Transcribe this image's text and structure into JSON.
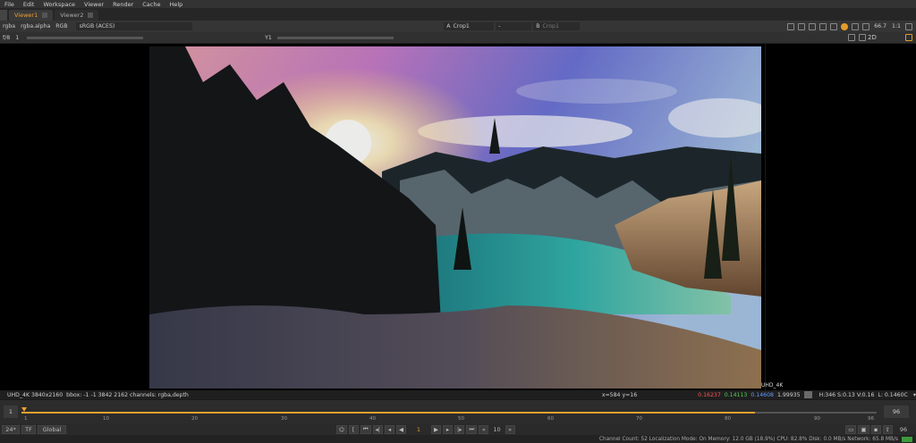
{
  "menu": [
    "File",
    "Edit",
    "Workspace",
    "Viewer",
    "Render",
    "Cache",
    "Help"
  ],
  "tabs": [
    {
      "label": "Viewer1",
      "active": true
    },
    {
      "label": "Viewer2",
      "active": false
    }
  ],
  "toolbar": {
    "channels": "rgba",
    "alpha": "rgba.alpha",
    "display": "RGB",
    "colorspace": "sRGB (ACES)",
    "input_a_letter": "A",
    "input_a": "Crop1",
    "input_a_op": "-",
    "input_b_letter": "B",
    "input_b": "Crop1",
    "zoom": "66.7",
    "ratio": "1:1"
  },
  "toolbar2": {
    "fstop": "f/8",
    "frame_field": "1",
    "y_label": "Y",
    "y_value": "1",
    "view_mode": "2D"
  },
  "viewer": {
    "image_format_label": "UHD_4K"
  },
  "infobar": {
    "format": "UHD_4K 3840x2160",
    "bbox": "bbox: -1 -1 3842 2162 channels: rgba,depth",
    "coords": "x=584 y=16",
    "r": "0.16237",
    "g": "0.14113",
    "b": "0.14608",
    "a": "1.99935",
    "hsv": "H:346 S:0.13 V:0.16",
    "l": "L: 0.1460C"
  },
  "timeline": {
    "start": "1",
    "end": "96",
    "ticks": [
      "1",
      "10",
      "20",
      "30",
      "40",
      "50",
      "60",
      "70",
      "80",
      "90",
      "96"
    ]
  },
  "controls": {
    "fps": "24*",
    "tf": "TF",
    "scope": "Global",
    "current_frame": "1",
    "step": "10",
    "end_frame": "96"
  },
  "status": {
    "text": "Channel Count: 52  Localization Mode: On  Memory: 12.0 GB (18.9%)  CPU: 82.8%  Disk: 0.0 MB/s  Network: 65.8 MB/s"
  },
  "colors": {
    "accent": "#f0a030",
    "r_color": "#ff5555",
    "g_color": "#55cc55",
    "b_color": "#6699ff"
  }
}
